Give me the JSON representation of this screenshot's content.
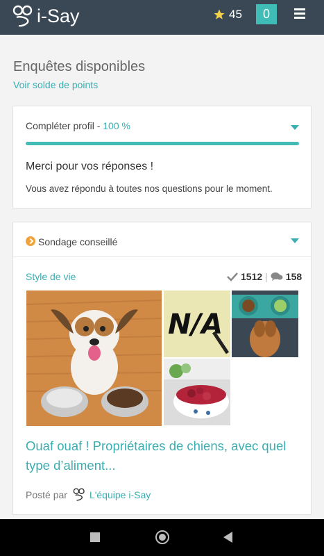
{
  "header": {
    "brand": "i-Say",
    "points": "45",
    "notifications": "0",
    "icons": [
      "isay-logo-icon",
      "star-icon",
      "menu-icon"
    ]
  },
  "page": {
    "title": "Enquêtes disponibles",
    "points_link": "Voir solde de points"
  },
  "profile_card": {
    "label": "Compléter profil - ",
    "percent": "100 %",
    "progress": 1.0,
    "thanks": "Merci pour vos réponses !",
    "message": "Vous avez répondu à toutes nos questions pour le moment."
  },
  "survey_card": {
    "header_label": "Sondage conseillé",
    "category": "Style de vie",
    "completions": "1512",
    "comments": "158",
    "title": "Ouaf ouaf ! Propriétaires de chiens, avec quel type d’aliment...",
    "posted_by_label": "Posté par",
    "team": "L'équipe i-Say",
    "images": [
      "dog-with-bowls",
      "n/a-handwriting",
      "dog-food-bowls",
      "raw-meat-bowl"
    ],
    "na_text": "N/A"
  },
  "colors": {
    "header_bg": "#3a4856",
    "accent": "#3aaeb0",
    "badge": "#f0a33a"
  }
}
